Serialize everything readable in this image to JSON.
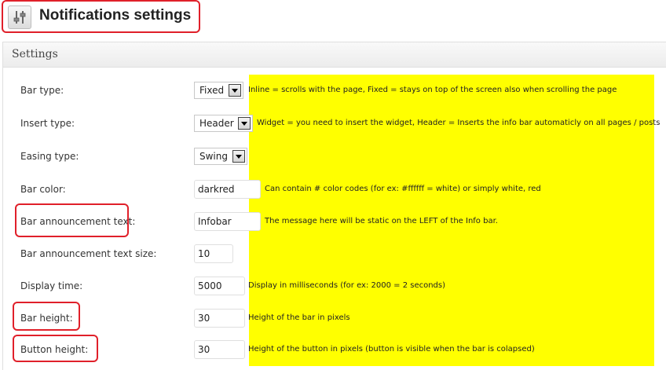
{
  "header": {
    "title": "Notifications settings",
    "icon": "settings-sliders-icon"
  },
  "panel": {
    "title": "Settings"
  },
  "settings": {
    "bar_type": {
      "label": "Bar type:",
      "value": "Fixed",
      "description": "Inline = scrolls with the page, Fixed = stays on top of the screen also when scrolling the page"
    },
    "insert_type": {
      "label": "Insert type:",
      "value": "Header",
      "description": "Widget = you need to insert the widget, Header = Inserts the info bar automaticly on all pages / posts"
    },
    "easing_type": {
      "label": "Easing type:",
      "value": "Swing"
    },
    "bar_color": {
      "label": "Bar color:",
      "value": "darkred",
      "description": "Can contain # color codes (for ex: #ffffff = white) or simply white, red"
    },
    "announcement_text": {
      "label": "Bar announcement text:",
      "value": "Infobar",
      "description": "The message here will be static on the LEFT of the Info bar."
    },
    "announcement_text_size": {
      "label": "Bar announcement text size:",
      "value": "10"
    },
    "display_time": {
      "label": "Display time:",
      "value": "5000",
      "description": "Display in milliseconds (for ex: 2000 = 2 seconds)"
    },
    "bar_height": {
      "label": "Bar height:",
      "value": "30",
      "description": "Height of the bar in pixels"
    },
    "button_height": {
      "label": "Button height:",
      "value": "30",
      "description": "Height of the button in pixels (button is visible when the bar is colapsed)"
    }
  },
  "colors": {
    "highlight": "#ffff00",
    "annotation": "#e0202a"
  }
}
